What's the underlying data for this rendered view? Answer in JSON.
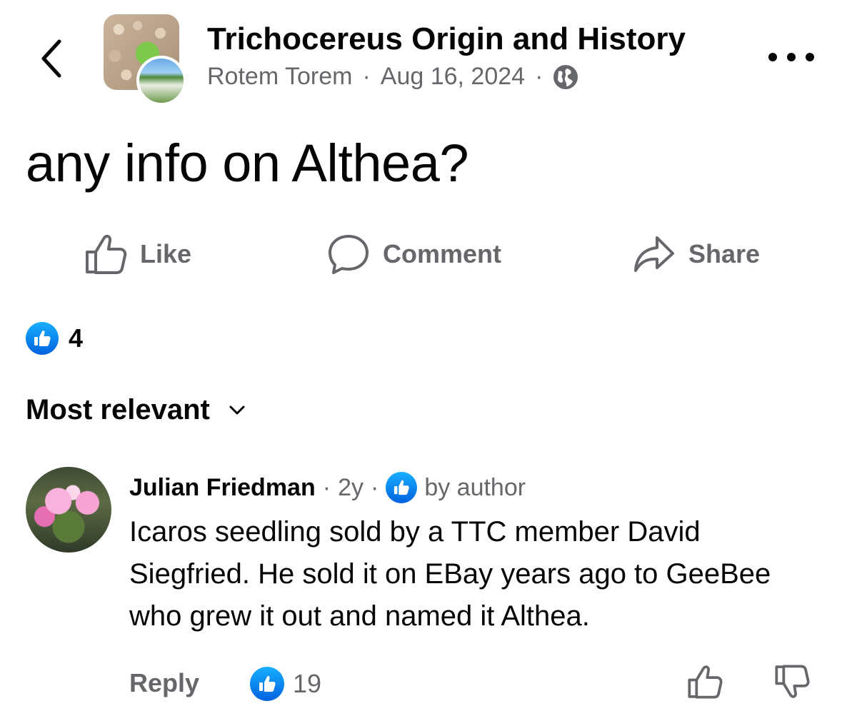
{
  "header": {
    "back_icon": "chevron-left-icon",
    "group_name": "Trichocereus Origin and History",
    "author": "Rotem Torem",
    "separator": "·",
    "date": "Aug 16, 2024",
    "privacy_icon": "globe-icon",
    "more_icon": "more-horizontal-icon"
  },
  "post": {
    "text": "any info on Althea?"
  },
  "actions": {
    "like_label": "Like",
    "comment_label": "Comment",
    "share_label": "Share"
  },
  "reactions": {
    "icon": "like-reaction-icon",
    "count": "4"
  },
  "sort": {
    "label": "Most relevant",
    "icon": "chevron-down-icon"
  },
  "comment": {
    "author": "Julian Friedman",
    "separator": "·",
    "time": "2y",
    "by_author_label": "by author",
    "text": "Icaros seedling sold by a TTC member David Siegfried. He sold it on EBay years ago to GeeBee who grew it out and named it Althea.",
    "reply_label": "Reply",
    "like_count": "19"
  },
  "colors": {
    "accent_blue": "#0866FF",
    "secondary_text": "#65676b",
    "primary_text": "#050505"
  }
}
